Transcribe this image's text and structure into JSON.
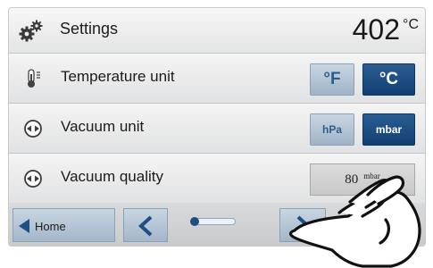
{
  "header": {
    "title": "Settings",
    "temperature": "402",
    "temperature_unit": "°C",
    "icon": "gears-icon"
  },
  "rows": [
    {
      "label": "Temperature unit",
      "icon": "thermometer-icon",
      "options": [
        {
          "label": "°F",
          "selected": false
        },
        {
          "label": "°C",
          "selected": true
        }
      ]
    },
    {
      "label": "Vacuum unit",
      "icon": "vacuum-gauge-icon",
      "options": [
        {
          "label": "hPa",
          "selected": false
        },
        {
          "label": "mbar",
          "selected": true
        }
      ]
    },
    {
      "label": "Vacuum quality",
      "icon": "vacuum-gauge-icon",
      "value": "80",
      "unit": "mbar"
    }
  ],
  "footer": {
    "home_label": "Home",
    "page_indicator_current": 1
  },
  "colors": {
    "accent": "#123f72",
    "inactive": "#a3b6c9",
    "background": "#e9eaeb"
  },
  "overlay": {
    "icon": "pointing-hand-icon"
  }
}
